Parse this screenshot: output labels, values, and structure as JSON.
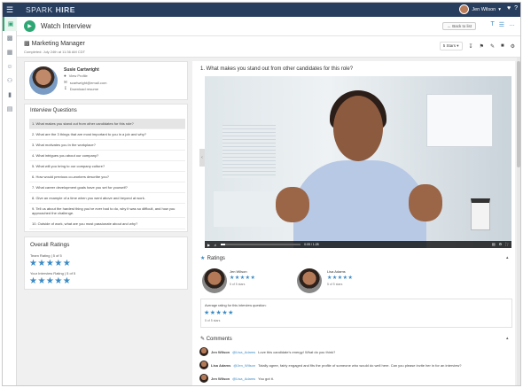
{
  "topbar": {
    "logo_a": "SPARK",
    "logo_b": "HIRE",
    "user_name": "Jen Wilson"
  },
  "header": {
    "title": "Watch Interview",
    "back_label": "Back to list",
    "tools": [
      "T",
      "☰",
      "…"
    ]
  },
  "subheader": {
    "job_title": "Marketing Manager",
    "job_sub": "Completed: July 24th at 11:36 AM CDT",
    "stars_label": "5 Stars"
  },
  "candidate": {
    "name": "Susie Cartwright",
    "profile_link": "View Profile",
    "email": "scartwright@email.com",
    "resume_link": "Download resume"
  },
  "questions": {
    "title": "Interview Questions",
    "items": [
      "1. What makes you stand out from other candidates for this role?",
      "2. What are the 3 things that are most important to you in a job and why?",
      "3. What motivates you in the workplace?",
      "4. What intrigues you about our company?",
      "5. What will you bring to our company culture?",
      "6. How would previous co-workers describe you?",
      "7. What career development goals have you set for yourself?",
      "8. Give an example of a time when you went above and beyond at work.",
      "9. Tell us about the hardest thing you've ever had to do, why it was so difficult, and how you approached the challenge.",
      "10. Outside of work, what are you most passionate about and why?"
    ]
  },
  "overall": {
    "title": "Overall Ratings",
    "team_label": "Team Rating",
    "team_value": "5 of 5",
    "your_label": "Your Interview Rating",
    "your_value": "5 of 5",
    "stars": "★★★★★"
  },
  "question_title": "1. What makes you stand out from other candidates for this role?",
  "video": {
    "time": "0:05 / 1:28",
    "progress": 0.06
  },
  "ratings": {
    "title": "Ratings",
    "raters": [
      {
        "name": "Jen Wilson",
        "stars": "★★★★★",
        "sub": "5 of 5 stars"
      },
      {
        "name": "Lisa Adams",
        "stars": "★★★★★",
        "sub": "5 of 5 stars"
      }
    ],
    "avg_label": "Average rating for this interview question:",
    "avg_stars": "★★★★★",
    "avg_sub": "5 of 5 stars"
  },
  "comments": {
    "title": "Comments",
    "items": [
      {
        "name": "Jen Wilson",
        "mention": "@Lisa_Adams",
        "text": "Love this candidate's energy! What do you think?",
        "time": ""
      },
      {
        "name": "Lisa Adams",
        "mention": "@Jen_Wilson",
        "text": "Totally agree, fairly engaged and fits the profile of someone who would do well here. Can you please invite her in for an interview?",
        "time": ""
      },
      {
        "name": "Jen Wilson",
        "mention": "@Lisa_Adams",
        "text": "You got it.",
        "time": ""
      }
    ]
  },
  "colors": {
    "nav": "#283e5e",
    "accent": "#2fa774",
    "star": "#3a8ac4"
  }
}
